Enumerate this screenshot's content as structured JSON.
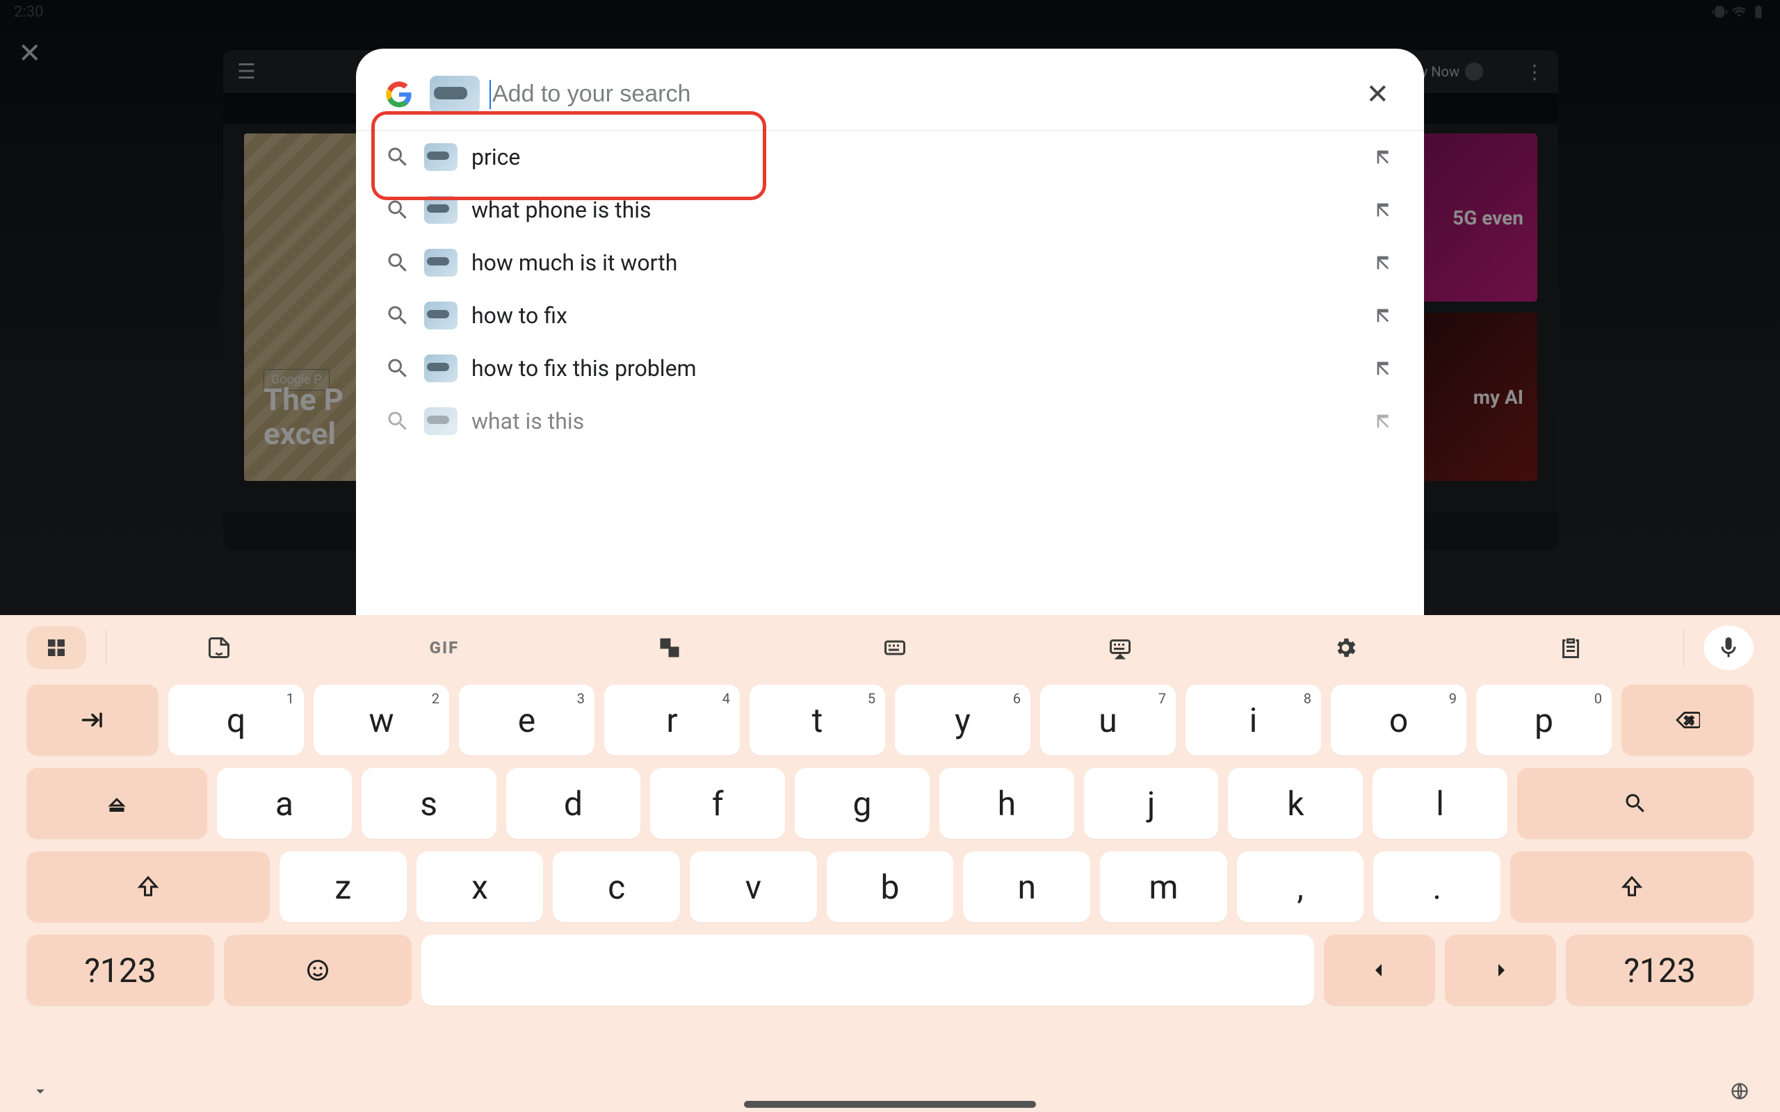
{
  "status": {
    "time": "2:30"
  },
  "bg": {
    "card_tag": "Google P",
    "card_title_line1": "The P",
    "card_title_line2": "excel",
    "card_r1": "5G even",
    "card_r2": "my AI",
    "play_now": "y Now"
  },
  "search": {
    "placeholder": "Add to your search",
    "value": ""
  },
  "suggestions": [
    {
      "text": "price"
    },
    {
      "text": "what phone is this"
    },
    {
      "text": "how much is it worth"
    },
    {
      "text": "how to fix"
    },
    {
      "text": "how to fix this problem"
    },
    {
      "text": "what is this"
    }
  ],
  "keyboard": {
    "gif": "GIF",
    "row1": [
      {
        "k": "q",
        "n": "1"
      },
      {
        "k": "w",
        "n": "2"
      },
      {
        "k": "e",
        "n": "3"
      },
      {
        "k": "r",
        "n": "4"
      },
      {
        "k": "t",
        "n": "5"
      },
      {
        "k": "y",
        "n": "6"
      },
      {
        "k": "u",
        "n": "7"
      },
      {
        "k": "i",
        "n": "8"
      },
      {
        "k": "o",
        "n": "9"
      },
      {
        "k": "p",
        "n": "0"
      }
    ],
    "row2": [
      "a",
      "s",
      "d",
      "f",
      "g",
      "h",
      "j",
      "k",
      "l"
    ],
    "row3": [
      "z",
      "x",
      "c",
      "v",
      "b",
      "n",
      "m",
      ",",
      "."
    ],
    "sym": "?123"
  }
}
